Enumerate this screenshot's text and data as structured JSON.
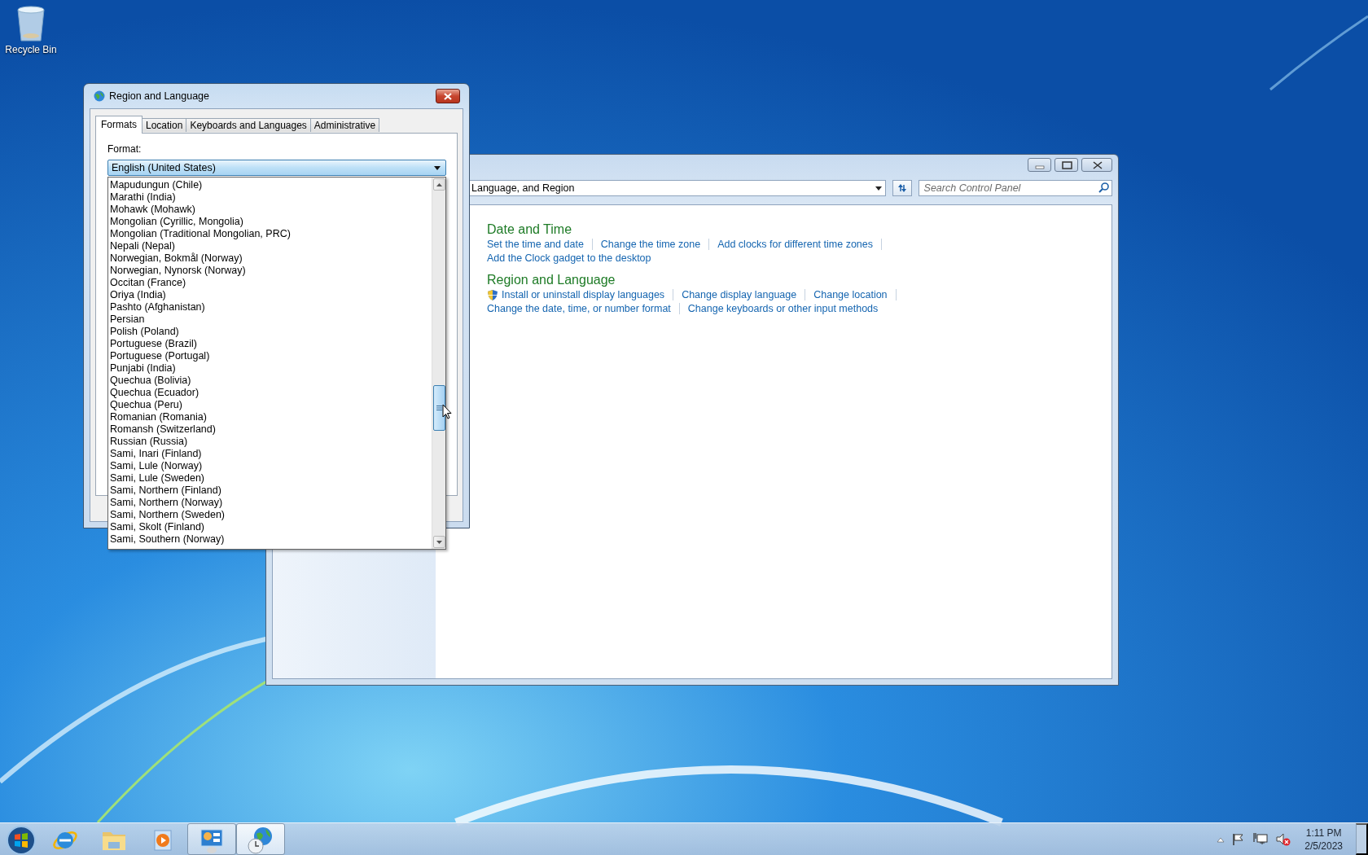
{
  "desktop_icons": [
    {
      "label": "Recycle Bin"
    }
  ],
  "control_panel": {
    "address": "Language, and Region",
    "search": {
      "placeholder": "Search Control Panel"
    },
    "sections": [
      {
        "title": "Date and Time",
        "rows": [
          [
            {
              "text": "Set the time and date",
              "admin": false
            },
            {
              "text": "Change the time zone",
              "admin": false
            },
            {
              "text": "Add clocks for different time zones",
              "admin": false
            }
          ],
          [
            {
              "text": "Add the Clock gadget to the desktop",
              "admin": false
            }
          ]
        ]
      },
      {
        "title": "Region and Language",
        "rows": [
          [
            {
              "text": "Install or uninstall display languages",
              "admin": true
            },
            {
              "text": "Change display language",
              "admin": false
            },
            {
              "text": "Change location",
              "admin": false
            }
          ],
          [
            {
              "text": "Change the date, time, or number format",
              "admin": false
            },
            {
              "text": "Change keyboards or other input methods",
              "admin": false
            }
          ]
        ]
      }
    ]
  },
  "dialog": {
    "title": "Region and Language",
    "tabs": [
      {
        "label": "Formats",
        "selected": true
      },
      {
        "label": "Location",
        "selected": false
      },
      {
        "label": "Keyboards and Languages",
        "selected": false
      },
      {
        "label": "Administrative",
        "selected": false
      }
    ],
    "format_label": "Format:",
    "format": {
      "value": "English (United States)",
      "expanded": true,
      "options": [
        "Mapudungun (Chile)",
        "Marathi (India)",
        "Mohawk (Mohawk)",
        "Mongolian (Cyrillic, Mongolia)",
        "Mongolian (Traditional Mongolian, PRC)",
        "Nepali (Nepal)",
        "Norwegian, Bokmål (Norway)",
        "Norwegian, Nynorsk (Norway)",
        "Occitan (France)",
        "Oriya (India)",
        "Pashto (Afghanistan)",
        "Persian",
        "Polish (Poland)",
        "Portuguese (Brazil)",
        "Portuguese (Portugal)",
        "Punjabi (India)",
        "Quechua (Bolivia)",
        "Quechua (Ecuador)",
        "Quechua (Peru)",
        "Romanian (Romania)",
        "Romansh (Switzerland)",
        "Russian (Russia)",
        "Sami, Inari (Finland)",
        "Sami, Lule (Norway)",
        "Sami, Lule (Sweden)",
        "Sami, Northern (Finland)",
        "Sami, Northern (Norway)",
        "Sami, Northern (Sweden)",
        "Sami, Skolt (Finland)",
        "Sami, Southern (Norway)"
      ]
    }
  },
  "taskbar": {
    "buttons": [
      {
        "kind": "start",
        "open": false,
        "selected": false
      },
      {
        "kind": "browser",
        "open": false,
        "selected": false
      },
      {
        "kind": "folder",
        "open": false,
        "selected": false
      },
      {
        "kind": "media",
        "open": false,
        "selected": false
      },
      {
        "kind": "control-panel",
        "open": true,
        "selected": false
      },
      {
        "kind": "region",
        "open": true,
        "selected": true
      }
    ],
    "clock": {
      "time": "1:11 PM",
      "date": "2/5/2023"
    }
  }
}
